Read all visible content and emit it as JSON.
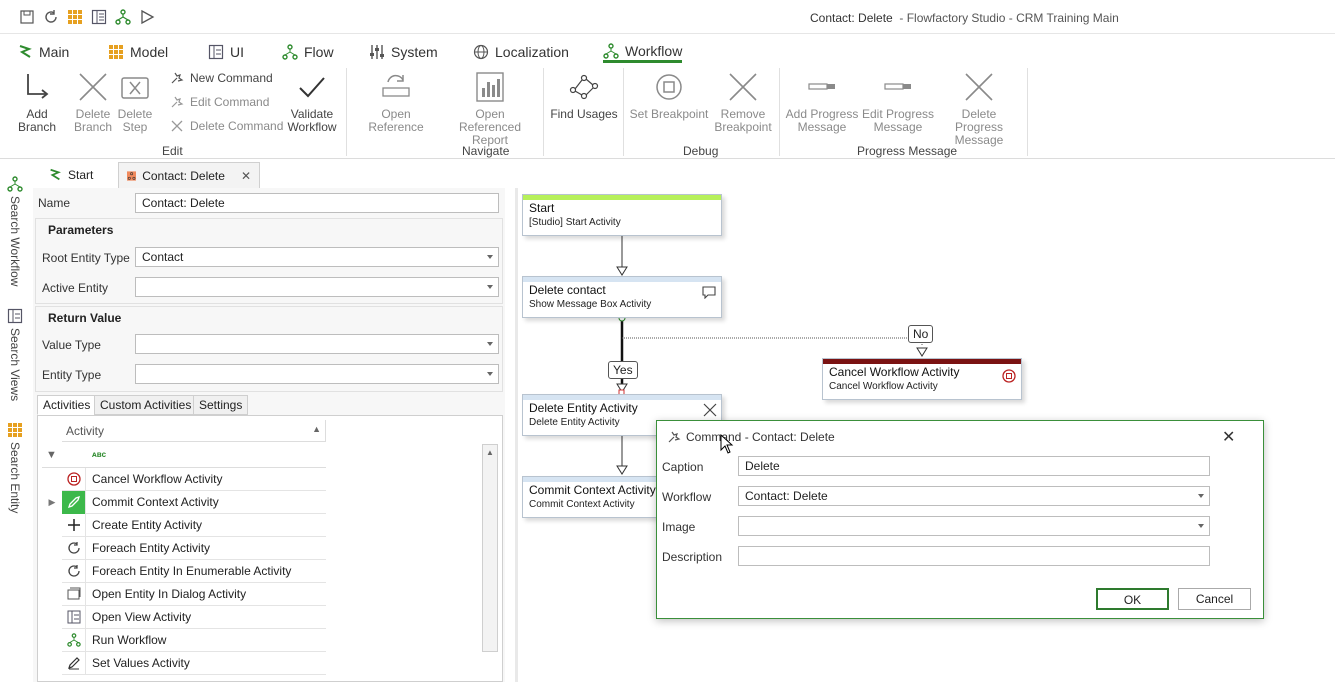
{
  "window": {
    "doc_title": "Contact: Delete",
    "app_title": "- Flowfactory Studio - CRM Training Main"
  },
  "quick_access": [
    "save-icon",
    "refresh-icon",
    "grid-icon",
    "view-icon",
    "workflow-icon",
    "run-icon"
  ],
  "ribbon_tabs": [
    {
      "label": "Main",
      "icon": "main-icon"
    },
    {
      "label": "Model",
      "icon": "grid-icon"
    },
    {
      "label": "UI",
      "icon": "view-icon"
    },
    {
      "label": "Flow",
      "icon": "flow-icon"
    },
    {
      "label": "System",
      "icon": "system-icon"
    },
    {
      "label": "Localization",
      "icon": "globe-icon"
    },
    {
      "label": "Workflow",
      "icon": "workflow-icon",
      "active": true
    }
  ],
  "ribbon": {
    "edit": {
      "add_branch": [
        "Add Branch"
      ],
      "delete_branch": [
        "Delete",
        "Branch"
      ],
      "delete_step": [
        "Delete",
        "Step"
      ],
      "new_command": "New Command",
      "edit_command": "Edit Command",
      "delete_command": "Delete Command",
      "validate_workflow": [
        "Validate",
        "Workflow"
      ],
      "group_label": "Edit"
    },
    "navigate": {
      "open_reference": [
        "Open Reference"
      ],
      "open_referenced_report": [
        "Open Referenced",
        "Report"
      ],
      "find_usages": [
        "Find Usages"
      ],
      "group_label": "Navigate"
    },
    "debug": {
      "set_breakpoint": [
        "Set Breakpoint"
      ],
      "remove_breakpoint": [
        "Remove",
        "Breakpoint"
      ],
      "group_label": "Debug"
    },
    "progress": {
      "add_progress": [
        "Add Progress",
        "Message"
      ],
      "edit_progress": [
        "Edit Progress",
        "Message"
      ],
      "delete_progress": [
        "Delete Progress",
        "Message"
      ],
      "group_label": "Progress Message"
    }
  },
  "left_rail": [
    {
      "label": "Search Workflow",
      "icon": "workflow-icon"
    },
    {
      "label": "Search Views",
      "icon": "view-icon"
    },
    {
      "label": "Search Entity",
      "icon": "grid-icon"
    }
  ],
  "doc_tabs": [
    {
      "label": "Start"
    },
    {
      "label": "Contact: Delete",
      "active": true
    }
  ],
  "props": {
    "name_label": "Name",
    "name_value": "Contact: Delete",
    "parameters_title": "Parameters",
    "root_entity_type_label": "Root Entity Type",
    "root_entity_type_value": "Contact",
    "active_entity_label": "Active Entity",
    "active_entity_value": "",
    "return_value_title": "Return Value",
    "value_type_label": "Value Type",
    "value_type_value": "",
    "entity_type_label": "Entity Type",
    "entity_type_value": ""
  },
  "panel_tabs": [
    "Activities",
    "Custom Activities",
    "Settings"
  ],
  "activities": {
    "column_header": "Activity",
    "items": [
      {
        "label": "Cancel Workflow Activity",
        "icon": "stop-icon"
      },
      {
        "label": "Commit Context Activity",
        "icon": "rocket-icon"
      },
      {
        "label": "Create Entity Activity",
        "icon": "plus-icon"
      },
      {
        "label": "Foreach Entity Activity",
        "icon": "loop-icon"
      },
      {
        "label": "Foreach Entity In Enumerable Activity",
        "icon": "loop-icon"
      },
      {
        "label": "Open Entity In Dialog Activity",
        "icon": "dialog-icon"
      },
      {
        "label": "Open View Activity",
        "icon": "view-icon"
      },
      {
        "label": "Run Workflow",
        "icon": "workflow-icon"
      },
      {
        "label": "Set Values Activity",
        "icon": "pencil-icon"
      }
    ]
  },
  "canvas": {
    "nodes": [
      {
        "title": "Start",
        "subtitle": "[Studio] Start Activity",
        "bar_color": "#b6f05a"
      },
      {
        "title": "Delete contact",
        "subtitle": "Show Message Box  Activity",
        "bar_color": "#d6e4f2"
      },
      {
        "title": "Cancel Workflow Activity",
        "subtitle": "Cancel Workflow Activity",
        "bar_color": "#7a1212"
      },
      {
        "title": "Delete Entity Activity",
        "subtitle": "Delete Entity Activity",
        "bar_color": "#d6e4f2"
      },
      {
        "title": "Commit Context Activity",
        "subtitle": "Commit Context Activity",
        "bar_color": "#d6e4f2"
      }
    ],
    "branch_yes": "Yes",
    "branch_no": "No"
  },
  "dialog": {
    "title": "Command - Contact: Delete",
    "caption_label": "Caption",
    "caption_value": "Delete",
    "workflow_label": "Workflow",
    "workflow_value": "Contact: Delete",
    "image_label": "Image",
    "image_value": "",
    "description_label": "Description",
    "description_value": "",
    "ok": "OK",
    "cancel": "Cancel"
  },
  "colors": {
    "accent_green": "#2e8b2e",
    "start_bar": "#b6f05a",
    "cancel_bar": "#7a1212"
  }
}
